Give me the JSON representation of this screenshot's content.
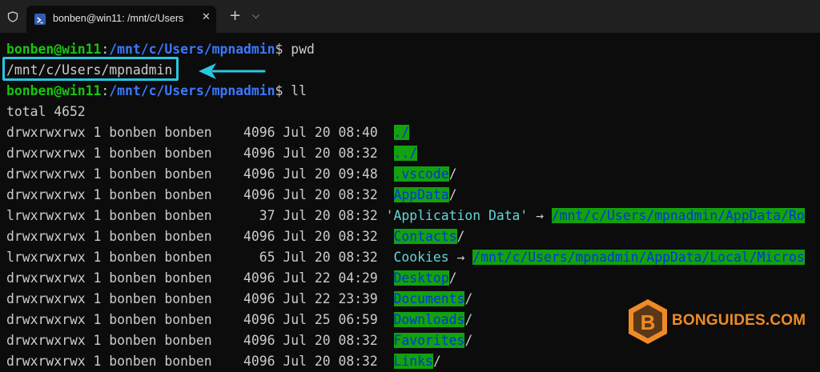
{
  "window": {
    "tab_title": "bonben@win11: /mnt/c/Users",
    "close_glyph": "✕",
    "new_tab_glyph": "+",
    "dropdown_glyph": "⌵"
  },
  "colors": {
    "prompt_user": "#16c60c",
    "prompt_path": "#3b78ff",
    "dir_highlight_bg": "#13a10e",
    "dir_highlight_fg": "#0037da",
    "symlink_name": "#61d6d6",
    "annotation": "#29c6e0",
    "watermark": "#ef8b25"
  },
  "terminal": {
    "prompt1": {
      "user": "bonben@win11",
      "colon": ":",
      "path": "/mnt/c/Users/mpnadmin",
      "dollar": "$ ",
      "command": "pwd"
    },
    "pwd_output": "/mnt/c/Users/mpnadmin",
    "prompt2": {
      "user": "bonben@win11",
      "colon": ":",
      "path": "/mnt/c/Users/mpnadmin",
      "dollar": "$ ",
      "command": "ll"
    },
    "total": "total 4652",
    "listing": [
      {
        "prefix": "drwxrwxrwx 1 bonben bonben    4096 Jul 20 08:40  ",
        "name": "./",
        "suffix": "/"
      },
      {
        "prefix": "drwxrwxrwx 1 bonben bonben    4096 Jul 20 08:32  ",
        "name": "../",
        "suffix": "/"
      },
      {
        "prefix": "drwxrwxrwx 1 bonben bonben    4096 Jul 20 09:48  ",
        "name": ".vscode",
        "suffix": "/"
      },
      {
        "prefix": "drwxrwxrwx 1 bonben bonben    4096 Jul 20 08:32  ",
        "name": "AppData",
        "suffix": "/"
      },
      {
        "prefix": "lrwxrwxrwx 1 bonben bonben      37 Jul 20 08:32 ",
        "name": "'Application Data'",
        "arrow": " → ",
        "target": "/mnt/c/Users/mpnadmin/AppData/Ro"
      },
      {
        "prefix": "drwxrwxrwx 1 bonben bonben    4096 Jul 20 08:32  ",
        "name": "Contacts",
        "suffix": "/"
      },
      {
        "prefix": "lrwxrwxrwx 1 bonben bonben      65 Jul 20 08:32  ",
        "name": "Cookies",
        "arrow": " → ",
        "target": "/mnt/c/Users/mpnadmin/AppData/Local/Micros"
      },
      {
        "prefix": "drwxrwxrwx 1 bonben bonben    4096 Jul 22 04:29  ",
        "name": "Desktop",
        "suffix": "/"
      },
      {
        "prefix": "drwxrwxrwx 1 bonben bonben    4096 Jul 22 23:39  ",
        "name": "Documents",
        "suffix": "/"
      },
      {
        "prefix": "drwxrwxrwx 1 bonben bonben    4096 Jul 25 06:59  ",
        "name": "Downloads",
        "suffix": "/"
      },
      {
        "prefix": "drwxrwxrwx 1 bonben bonben    4096 Jul 20 08:32  ",
        "name": "Favorites",
        "suffix": "/"
      },
      {
        "prefix": "drwxrwxrwx 1 bonben bonben    4096 Jul 20 08:32  ",
        "name": "Links",
        "suffix": "/"
      }
    ]
  },
  "watermark": {
    "text": "BONGUIDES.COM",
    "logo_letter": "B"
  }
}
